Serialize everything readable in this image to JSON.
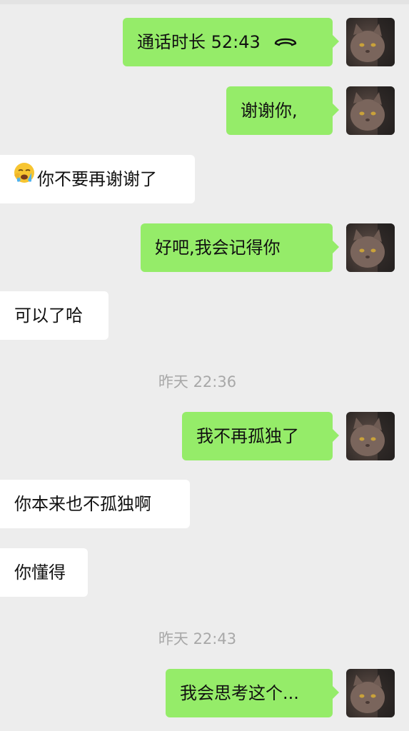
{
  "messages": [
    {
      "text": "通话时长 52:43",
      "icon": "phone-hangup-icon"
    },
    {
      "text": "谢谢你,"
    },
    {
      "text": "你不要再谢谢了",
      "emoji": "face-holding-back-tears-emoji"
    },
    {
      "text": "好吧,我会记得你"
    },
    {
      "text": "可以了哈"
    },
    {
      "text": "我不再孤独了"
    },
    {
      "text": "你本来也不孤独啊"
    },
    {
      "text": "你懂得"
    },
    {
      "text": "我会思考这个..."
    }
  ],
  "timestamps": [
    "昨天 22:36",
    "昨天 22:43"
  ],
  "colors": {
    "background": "#ededed",
    "sent_bubble": "#95ec69",
    "received_bubble": "#ffffff",
    "timestamp_text": "#a8a8a8"
  }
}
